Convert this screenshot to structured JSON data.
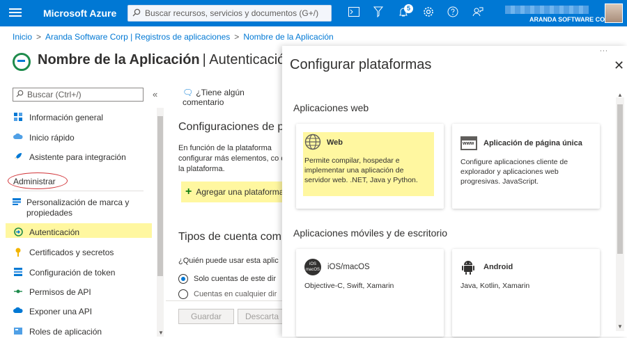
{
  "topbar": {
    "brand": "Microsoft Azure",
    "search_placeholder": "Buscar recursos, servicios y documentos (G+/)",
    "notification_count": "5",
    "account_org": "ARANDA SOFTWARE CORP"
  },
  "breadcrumb": [
    "Inicio",
    "Aranda Software Corp | Registros de aplicaciones",
    "Nombre de la Aplicación"
  ],
  "page": {
    "title": "Nombre de la Aplicación",
    "subtitle": "| Autenticación"
  },
  "sidebar": {
    "search_placeholder": "Buscar (Ctrl+/)",
    "collapse": "«",
    "top_items": [
      {
        "label": "Información general",
        "icon": "grid-icon"
      },
      {
        "label": "Inicio rápido",
        "icon": "cloud-icon"
      },
      {
        "label": "Asistente para integración",
        "icon": "rocket-icon"
      }
    ],
    "section": "Administrar",
    "items": [
      {
        "label": "Personalización de marca y propiedades",
        "icon": "branding-icon"
      },
      {
        "label": "Autenticación",
        "icon": "auth-icon"
      },
      {
        "label": "Certificados y secretos",
        "icon": "key-icon"
      },
      {
        "label": "Configuración de token",
        "icon": "token-icon"
      },
      {
        "label": "Permisos de API",
        "icon": "api-permissions-icon"
      },
      {
        "label": "Exponer una API",
        "icon": "cloud-api-icon"
      },
      {
        "label": "Roles de aplicación",
        "icon": "roles-icon"
      }
    ]
  },
  "content": {
    "feedback": "¿Tiene algún comentario",
    "platform_heading": "Configuraciones de p",
    "platform_desc": "En función de la plataforma configurar más elementos, co de la plataforma.",
    "add_platform": "Agregar una plataforma",
    "account_heading": "Tipos de cuenta com",
    "account_question": "¿Quién puede usar esta aplic",
    "radio1": "Solo cuentas de este dir",
    "radio2": "Cuentas en cualquier dir",
    "save": "Guardar",
    "discard": "Descarta"
  },
  "panel": {
    "title": "Configurar plataformas",
    "close": "✕",
    "web_section": "Aplicaciones web",
    "mobile_section": "Aplicaciones móviles y de escritorio",
    "cards": {
      "web": {
        "title": "Web",
        "desc": "Permite compilar, hospedar e implementar una aplicación de servidor web. .NET, Java y Python."
      },
      "spa": {
        "title": "Aplicación de página única",
        "desc": "Configure aplicaciones cliente de explorador y aplicaciones web progresivas. JavaScript.",
        "icon_text": "www"
      },
      "ios": {
        "title": "iOS/macOS",
        "desc": "Objective-C, Swift, Xamarin",
        "icon_text": "iOS macOS"
      },
      "android": {
        "title": "Android",
        "desc": "Java, Kotlin, Xamarin"
      }
    }
  },
  "colors": {
    "accent": "#0078d4",
    "highlight": "#fff7a0",
    "annotation": "#d13438"
  }
}
